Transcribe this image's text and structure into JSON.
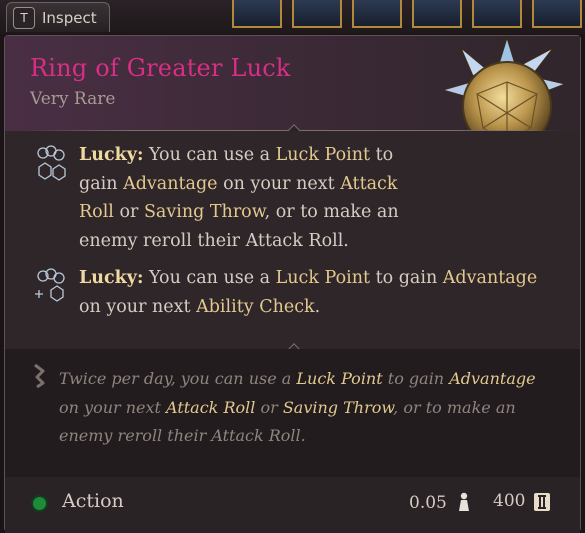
{
  "inspect_tab": {
    "key": "T",
    "label": "Inspect"
  },
  "item": {
    "name": "Ring of Greater Luck",
    "rarity": "Very Rare",
    "image_icon": "spiked-golden-orb-icon"
  },
  "features": [
    {
      "icon": "lucky-dice-icon",
      "parts": [
        {
          "t": "Lucky:",
          "s": "name"
        },
        {
          "t": " You can use a ",
          "s": "plain"
        },
        {
          "t": "Luck Point",
          "s": "kw"
        },
        {
          "t": " to gain ",
          "s": "plain"
        },
        {
          "t": "Advantage",
          "s": "kw"
        },
        {
          "t": " on your next ",
          "s": "plain"
        },
        {
          "t": "Attack Roll",
          "s": "kw"
        },
        {
          "t": " or ",
          "s": "plain"
        },
        {
          "t": "Saving Throw",
          "s": "kw"
        },
        {
          "t": ", or to make an enemy reroll their Attack Roll.",
          "s": "plain"
        }
      ]
    },
    {
      "icon": "lucky-dice-plus-icon",
      "parts": [
        {
          "t": "Lucky:",
          "s": "name"
        },
        {
          "t": " You can use a ",
          "s": "plain"
        },
        {
          "t": "Luck Point",
          "s": "kw"
        },
        {
          "t": " to gain ",
          "s": "plain"
        },
        {
          "t": "Advantage",
          "s": "kw"
        },
        {
          "t": " on your next ",
          "s": "plain"
        },
        {
          "t": "Ability Check",
          "s": "kw"
        },
        {
          "t": ".",
          "s": "plain"
        }
      ]
    }
  ],
  "flavor": {
    "icon": "quill-icon",
    "parts": [
      {
        "t": "Twice per day, you can use a ",
        "s": "plain"
      },
      {
        "t": "Luck Point",
        "s": "kw"
      },
      {
        "t": " to gain ",
        "s": "plain"
      },
      {
        "t": "Advantage",
        "s": "kw"
      },
      {
        "t": " on your next ",
        "s": "plain"
      },
      {
        "t": "Attack Roll",
        "s": "kw"
      },
      {
        "t": " or ",
        "s": "plain"
      },
      {
        "t": "Saving Throw",
        "s": "kw"
      },
      {
        "t": ", or to make an enemy reroll their Attack Roll.",
        "s": "plain"
      }
    ]
  },
  "footer": {
    "action_label": "Action",
    "action_color": "#1f8a3a",
    "weight": "0.05",
    "weight_icon": "weight-icon",
    "value": "400",
    "value_icon": "gold-coin-icon"
  },
  "colors": {
    "title": "#d92e86",
    "keyword": "#e3c98f",
    "body_text": "#d7ccc3",
    "flavor_text": "#8f847e"
  }
}
